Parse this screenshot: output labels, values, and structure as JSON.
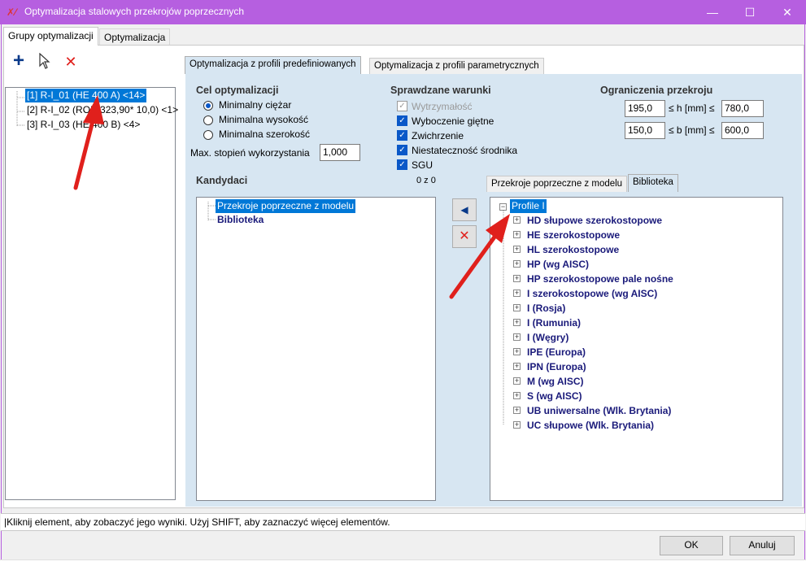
{
  "window": {
    "title": "Optymalizacja stalowych przekrojów poprzecznych",
    "minimize": "—",
    "maximize": "☐",
    "close": "✕"
  },
  "main_tabs": [
    "Grupy optymalizacji",
    "Optymalizacja"
  ],
  "toolbar": {
    "add": "+",
    "close": "✕"
  },
  "groups": [
    "[1] R-I_01 (HE  400 A) <14>",
    "[2] R-I_02 (ROR 323,90*  10,0) <1>",
    "[3] R-I_03 (HE 400 B) <4>"
  ],
  "opt_tabs": [
    "Optymalizacja z profili predefiniowanych",
    "Optymalizacja z profili parametrycznych"
  ],
  "goal": {
    "header": "Cel optymalizacji",
    "options": [
      "Minimalny ciężar",
      "Minimalna wysokość",
      "Minimalna szerokość"
    ],
    "selected": 0,
    "max_label": "Max. stopień wykorzystania",
    "max_value": "1,000"
  },
  "checks": {
    "header": "Sprawdzane warunki",
    "items": [
      {
        "label": "Wytrzymałość",
        "checked": true,
        "disabled": true
      },
      {
        "label": "Wyboczenie giętne",
        "checked": true,
        "disabled": false
      },
      {
        "label": "Zwichrzenie",
        "checked": true,
        "disabled": false
      },
      {
        "label": "Niestateczność środnika",
        "checked": true,
        "disabled": false
      },
      {
        "label": "SGU",
        "checked": true,
        "disabled": false
      }
    ]
  },
  "limits": {
    "header": "Ograniczenia przekroju",
    "h_min": "195,0",
    "h_label": "≤ h [mm] ≤",
    "h_max": "780,0",
    "b_min": "150,0",
    "b_label": "≤ b [mm] ≤",
    "b_max": "600,0"
  },
  "candidates": {
    "header": "Kandydaci",
    "count": "0 z 0",
    "items": [
      "Przekroje poprzeczne z modelu",
      "Biblioteka"
    ]
  },
  "move_buttons": {
    "left": "◀",
    "remove": "✕"
  },
  "lib_tabs": [
    "Przekroje poprzeczne z modelu",
    "Biblioteka"
  ],
  "library": {
    "root": "Profile I",
    "items": [
      "HD słupowe szerokostopowe",
      "HE szerokostopowe",
      "HL szerokostopowe",
      "HP (wg AISC)",
      "HP szerokostopowe pale nośne",
      "I   szerokostopowe (wg AISC)",
      "I (Rosja)",
      "I (Rumunia)",
      "I (Węgry)",
      "IPE (Europa)",
      "IPN (Europa)",
      "M   (wg AISC)",
      "S   (wg AISC)",
      "UB uniwersalne (Wlk. Brytania)",
      "UC słupowe (Wlk. Brytania)"
    ]
  },
  "status": "|Kliknij element, aby zobaczyć jego wyniki. Użyj SHIFT, aby zaznaczyć więcej elementów.",
  "buttons": {
    "ok": "OK",
    "cancel": "Anuluj"
  },
  "colors": {
    "titlebar": "#b65fe0",
    "panel": "#d7e6f2",
    "selection": "#0078d7",
    "arrow": "#e0201c"
  }
}
